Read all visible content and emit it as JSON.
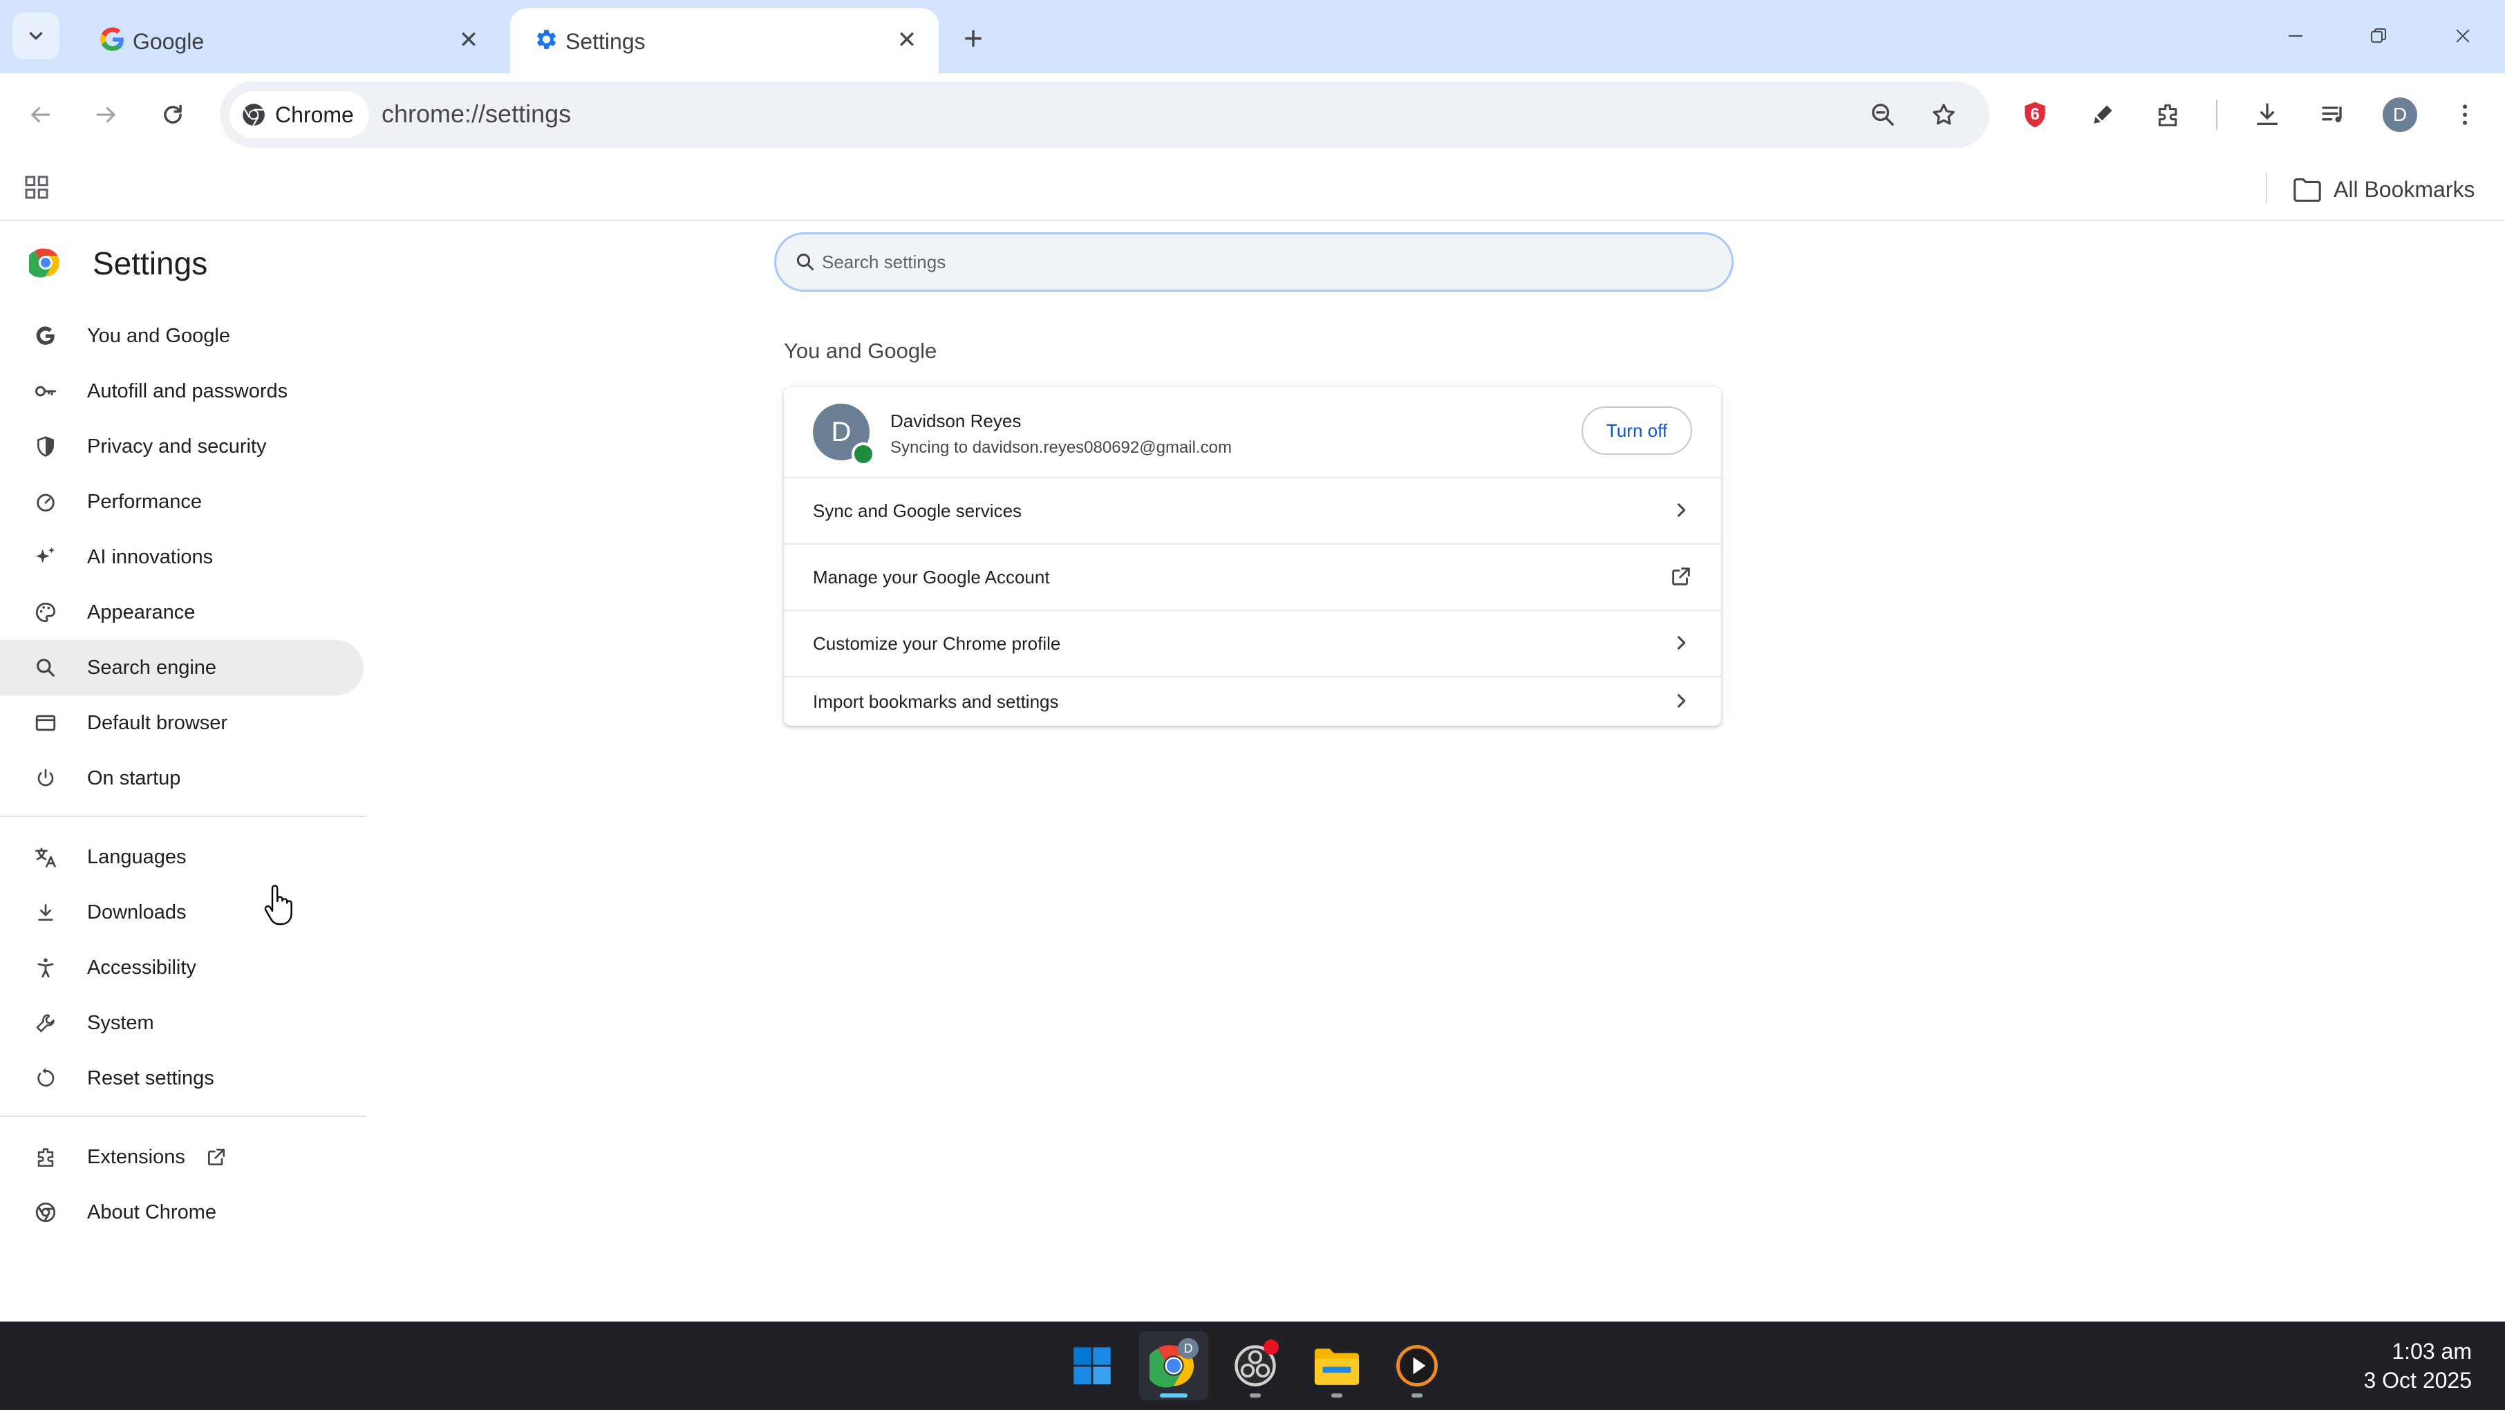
{
  "browser": {
    "tabs": [
      {
        "title": "Google",
        "icon": "google-g-icon",
        "active": false
      },
      {
        "title": "Settings",
        "icon": "gear-icon",
        "active": true
      }
    ],
    "omnibox": {
      "chip_label": "Chrome",
      "url": "chrome://settings"
    },
    "bookmarks": {
      "all_bookmarks_label": "All Bookmarks"
    },
    "extension_badge": "6",
    "profile_initial": "D"
  },
  "settings": {
    "title": "Settings",
    "search_placeholder": "Search settings",
    "nav": {
      "group1": [
        {
          "label": "You and Google",
          "icon": "google-g-icon"
        },
        {
          "label": "Autofill and passwords",
          "icon": "key-icon"
        },
        {
          "label": "Privacy and security",
          "icon": "shield-icon"
        },
        {
          "label": "Performance",
          "icon": "speedometer-icon"
        },
        {
          "label": "AI innovations",
          "icon": "sparkle-icon"
        },
        {
          "label": "Appearance",
          "icon": "palette-icon"
        },
        {
          "label": "Search engine",
          "icon": "search-icon"
        },
        {
          "label": "Default browser",
          "icon": "browser-window-icon"
        },
        {
          "label": "On startup",
          "icon": "power-icon"
        }
      ],
      "group2": [
        {
          "label": "Languages",
          "icon": "translate-icon"
        },
        {
          "label": "Downloads",
          "icon": "download-icon"
        },
        {
          "label": "Accessibility",
          "icon": "accessibility-icon"
        },
        {
          "label": "System",
          "icon": "wrench-icon"
        },
        {
          "label": "Reset settings",
          "icon": "reset-icon"
        }
      ],
      "group3": [
        {
          "label": "Extensions",
          "icon": "puzzle-icon"
        },
        {
          "label": "About Chrome",
          "icon": "chrome-icon"
        }
      ],
      "hovered_item": "Search engine"
    },
    "section_title": "You and Google",
    "account": {
      "initial": "D",
      "name": "Davidson Reyes",
      "sync_text": "Syncing to davidson.reyes080692@gmail.com",
      "turn_off_label": "Turn off"
    },
    "rows": [
      {
        "label": "Sync and Google services",
        "icon": "chevron-right-icon"
      },
      {
        "label": "Manage your Google Account",
        "icon": "open-in-new-icon"
      },
      {
        "label": "Customize your Chrome profile",
        "icon": "chevron-right-icon"
      },
      {
        "label": "Import bookmarks and settings",
        "icon": "chevron-right-icon"
      }
    ]
  },
  "taskbar": {
    "apps": [
      "windows-start-icon",
      "chrome-icon",
      "obs-icon",
      "file-explorer-icon",
      "media-player-icon"
    ],
    "chrome_badge": "D",
    "time": "1:03 am",
    "date": "3 Oct 2025"
  },
  "colors": {
    "tabstrip": "#d3e3fd",
    "accent_blue": "#0b57d0",
    "taskbar": "#1f2126"
  }
}
